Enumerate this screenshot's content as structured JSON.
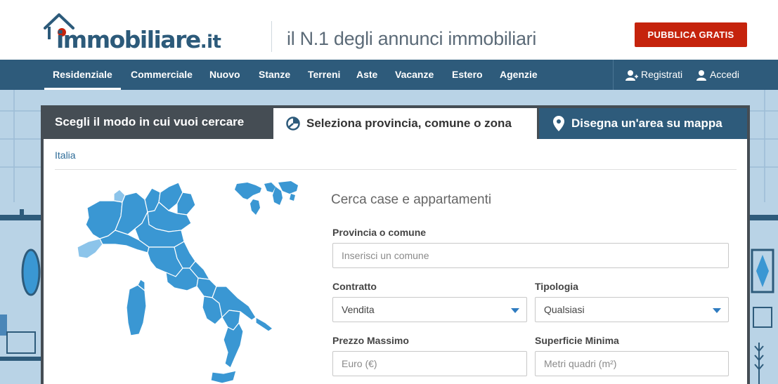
{
  "header": {
    "logo_text": "immobiliare",
    "logo_tld": ".it",
    "tagline": "il N.1 degli annunci immobiliari",
    "publish_label": "PUBBLICA GRATIS"
  },
  "nav": {
    "items": [
      {
        "label": "Residenziale",
        "active": true
      },
      {
        "label": "Commerciale"
      },
      {
        "label": "Nuovo"
      },
      {
        "label": "Stanze"
      },
      {
        "label": "Terreni"
      },
      {
        "label": "Aste"
      },
      {
        "label": "Vacanze"
      },
      {
        "label": "Estero"
      },
      {
        "label": "Agenzie"
      }
    ],
    "register_label": "Registrati",
    "login_label": "Accedi"
  },
  "search": {
    "heading": "Scegli il modo in cui vuoi cercare",
    "tabs": [
      {
        "label": "Seleziona provincia, comune o zona",
        "icon": "pie-chart-icon",
        "active": true
      },
      {
        "label": "Disegna un'area su mappa",
        "icon": "map-pin-icon"
      }
    ],
    "breadcrumb": "Italia",
    "form_title": "Cerca case e appartamenti",
    "fields": {
      "province_label": "Provincia o comune",
      "province_placeholder": "Inserisci un comune",
      "contract_label": "Contratto",
      "contract_value": "Vendita",
      "typology_label": "Tipologia",
      "typology_value": "Qualsiasi",
      "price_label": "Prezzo Massimo",
      "price_placeholder": "Euro (€)",
      "surface_label": "Superficie Minima",
      "surface_placeholder": "Metri quadri (m²)"
    }
  },
  "colors": {
    "nav_bg": "#2e5b7b",
    "publish_btn": "#c5230c",
    "map_region": "#3a97d3",
    "map_highlight": "#8cc4ea",
    "background": "#b9d3e6"
  }
}
